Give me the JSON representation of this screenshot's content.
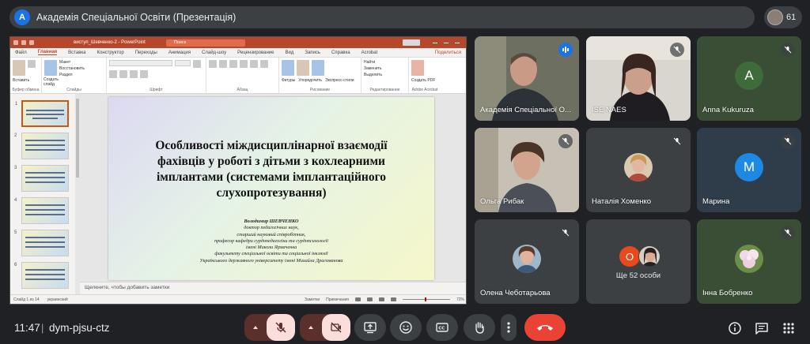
{
  "meeting": {
    "avatar_letter": "A",
    "title": "Академія Спеціальної Освіти (Презентація)",
    "participant_count": "61",
    "time": "11:47",
    "separator": "|",
    "code": "dym-pjsu-ctz"
  },
  "ppt": {
    "file_name": "виступ_Шевченко-2  -  PowerPoint",
    "search_placeholder": "Поиск",
    "tabs": [
      "Файл",
      "Главная",
      "Вставка",
      "Конструктор",
      "Переходы",
      "Анимация",
      "Слайд-шоу",
      "Рецензирование",
      "Вид",
      "Запись",
      "Справка",
      "Acrobat"
    ],
    "share_label": "Поделиться",
    "ribbon": {
      "paste": "Вставить",
      "new_slide": "Создать слайд",
      "layout": "Макет",
      "reset": "Восстановить",
      "section": "Раздел",
      "shapes": "Фигуры",
      "arrange": "Упорядочить",
      "quick_styles": "Экспресс-стили",
      "find": "Найти",
      "replace": "Заменить",
      "select": "Выделить",
      "create_pdf": "Создать PDF",
      "groups": [
        "Буфер обмена",
        "Слайды",
        "Шрифт",
        "Абзац",
        "Рисование",
        "Редактирование",
        "Adobe Acrobat"
      ]
    },
    "slide_numbers": [
      "1",
      "2",
      "3",
      "4",
      "5",
      "6"
    ],
    "slide": {
      "title": "Особливості міждисциплінарної взаємодії фахівців у роботі з дітьми з кохлеарними імплантами (системами імплантаційного слухопротезування)",
      "author_name": "Володимир ШЕВЧЕНКО",
      "author_lines": [
        "доктор педагогічних наук,",
        "старший науковий співробітник,",
        "професор кафедри сурдопедагогіки та сурдопсихології",
        "імені Миколи Ярмаченка",
        "факультету спеціальної освіти та соціальної інклюзії",
        "Українського державного університету імені Михайла Драгоманова"
      ]
    },
    "notes_placeholder": "Щелкните, чтобы добавить заметки",
    "status": {
      "slide_of": "Слайд 1 из 14",
      "language": "украинский",
      "notes": "Заметки",
      "comments": "Примечания",
      "zoom": "72%"
    }
  },
  "tiles": [
    {
      "name": "Академія Спеціальної О...",
      "kind": "video",
      "speaking": true
    },
    {
      "name": "ISE NAES",
      "kind": "video",
      "muted": true
    },
    {
      "name": "Anna Kukuruza",
      "kind": "letter",
      "letter": "A",
      "color": "#3d6b3a",
      "muted": true
    },
    {
      "name": "Ольга Рибак",
      "kind": "video",
      "muted": true
    },
    {
      "name": "Наталія Хоменко",
      "kind": "photo",
      "muted": true
    },
    {
      "name": "Марина",
      "kind": "letter",
      "letter": "M",
      "color": "#1e88e5",
      "muted": true
    },
    {
      "name": "Олена Чеботарьова",
      "kind": "photo",
      "muted": true
    },
    {
      "name": "Ще 52 особи",
      "kind": "others",
      "letter": "O",
      "color": "#e8491d"
    },
    {
      "name": "Інна Бобренко",
      "kind": "photo",
      "muted": true
    }
  ],
  "colors": {
    "background": "#202124",
    "end_call": "#ea4335",
    "mute_active": "#f9dedc",
    "accent": "#8ab4f8"
  }
}
